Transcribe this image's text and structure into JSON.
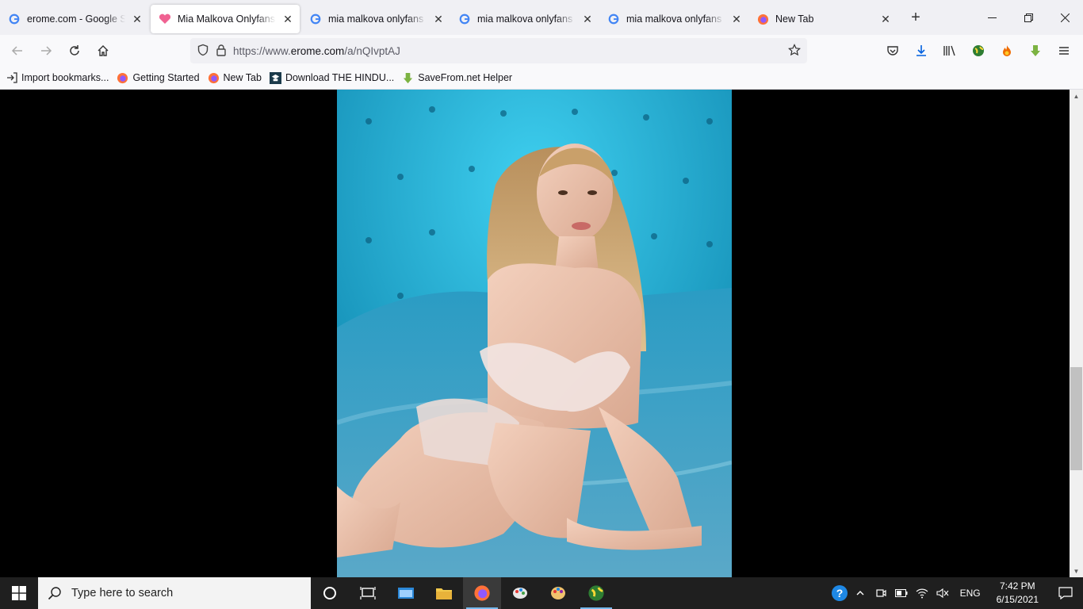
{
  "tabs": [
    {
      "title": "erome.com - Google Search",
      "favicon": "google-icon",
      "active": false
    },
    {
      "title": "Mia Malkova Onlyfans Bio",
      "favicon": "heart-icon",
      "active": true
    },
    {
      "title": "mia malkova onlyfans - Google Search",
      "favicon": "google-icon",
      "active": false
    },
    {
      "title": "mia malkova onlyfans - Google Search",
      "favicon": "google-icon",
      "active": false
    },
    {
      "title": "mia malkova onlyfans - Google Search",
      "favicon": "google-icon",
      "active": false
    },
    {
      "title": "New Tab",
      "favicon": "firefox-icon",
      "active": false
    }
  ],
  "urlbar": {
    "prefix": "https://www.",
    "domain": "erome.com",
    "path": "/a/nQIvptAJ"
  },
  "bookmarks": [
    {
      "label": "Import bookmarks...",
      "icon": "import-icon"
    },
    {
      "label": "Getting Started",
      "icon": "firefox-icon"
    },
    {
      "label": "New Tab",
      "icon": "firefox-icon"
    },
    {
      "label": "Download THE HINDU...",
      "icon": "hindu-icon"
    },
    {
      "label": "SaveFrom.net Helper",
      "icon": "savefrom-icon"
    }
  ],
  "taskbar": {
    "search_placeholder": "Type here to search",
    "language": "ENG",
    "time": "7:42 PM",
    "date": "6/15/2021"
  },
  "colors": {
    "tabstrip": "#f0f0f4",
    "toolbar": "#f9f9fb",
    "taskbar": "#1f1f1f",
    "photo_bg": "#1a9ec8"
  }
}
